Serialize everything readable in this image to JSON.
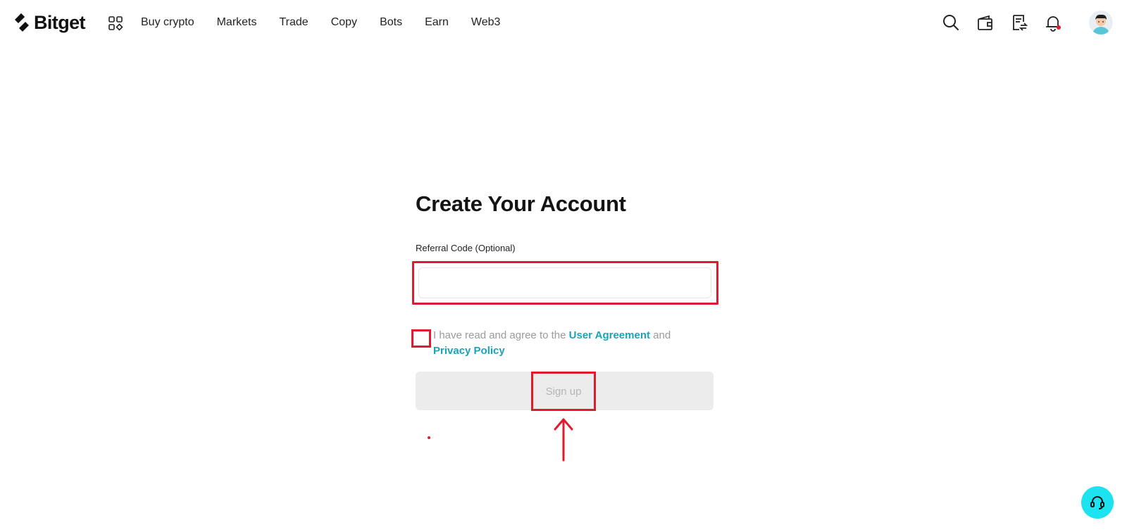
{
  "brand": {
    "name": "Bitget"
  },
  "nav": {
    "items": [
      "Buy crypto",
      "Markets",
      "Trade",
      "Copy",
      "Bots",
      "Earn",
      "Web3"
    ]
  },
  "header_actions": {
    "icons": [
      "search-icon",
      "wallet-icon",
      "orders-icon",
      "notification-bell-icon",
      "avatar"
    ]
  },
  "form": {
    "title": "Create Your Account",
    "referral": {
      "label": "Referral Code (Optional)",
      "value": "",
      "placeholder": ""
    },
    "agreement": {
      "checked": false,
      "text_before": "I have read and agree to the ",
      "user_agreement": "User Agreement",
      "text_middle": " and ",
      "privacy_policy": "Privacy Policy"
    },
    "signup_label": "Sign up"
  },
  "colors": {
    "highlight": "#e01b2b",
    "link": "#1aa3b8",
    "support": "#1de2f0",
    "disabled_button": "#ececec"
  }
}
